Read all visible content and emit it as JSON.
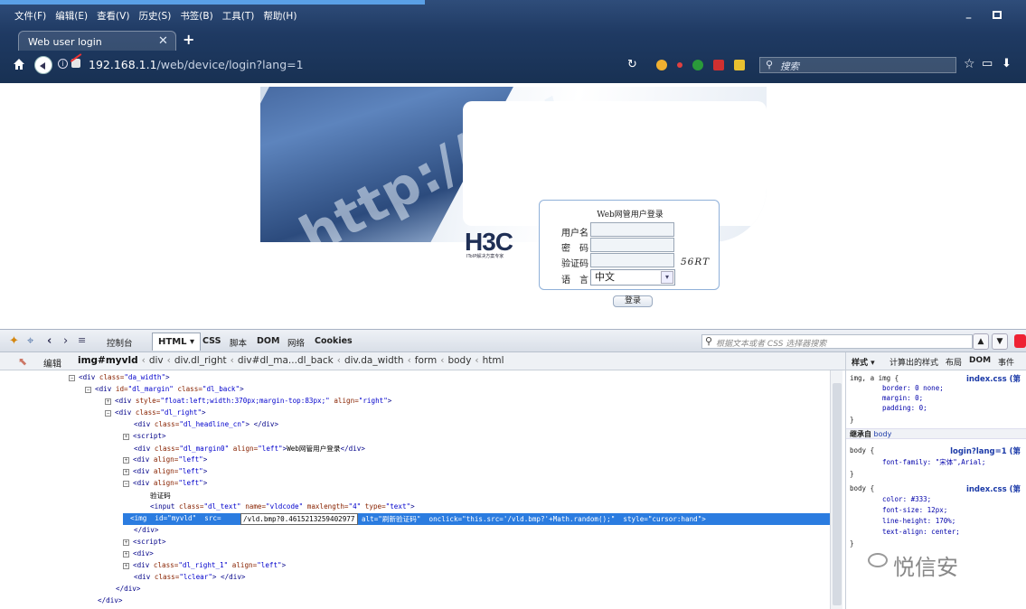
{
  "browser": {
    "menu": [
      "文件(F)",
      "编辑(E)",
      "查看(V)",
      "历史(S)",
      "书签(B)",
      "工具(T)",
      "帮助(H)"
    ],
    "tab_title": "Web user login",
    "tab_close": "✕",
    "new_tab": "+",
    "url_host": "192.168.1.1",
    "url_path": "/web/device/login?lang=1",
    "search_placeholder": "搜索",
    "minimize": "–"
  },
  "login_page": {
    "banner_text": "http://ww",
    "logo": "H3C",
    "logo_tagline": "IToIP解决方案专家",
    "title": "Web网管用户登录",
    "username_label": "用户名",
    "password_label": "密　码",
    "captcha_label": "验证码",
    "captcha_value": "56RT",
    "language_label": "语　言",
    "language_value": "中文",
    "login_button": "登录"
  },
  "firebug": {
    "tabs": [
      "控制台",
      "HTML ▾",
      "CSS",
      "脚本",
      "DOM",
      "网络",
      "Cookies"
    ],
    "search_placeholder": "根据文本或者 CSS 选择器搜索",
    "edit_label": "编辑",
    "breadcrumb_first": "img#myvld",
    "breadcrumbs": [
      "div",
      "div.dl_right",
      "div#dl_ma...dl_back",
      "div.da_width",
      "form",
      "body",
      "html"
    ],
    "edit_value": "/vld.bmp?0.4615213259402977",
    "side_tabs": [
      "样式 ▾",
      "计算出的样式",
      "布局",
      "DOM",
      "事件"
    ],
    "inherit_label": "继承自",
    "inherit_from": "body",
    "css_rules": [
      {
        "selector": "img, a img {",
        "source": "index.css (第",
        "props": [
          "border: 0 none;",
          "margin: 0;",
          "padding: 0;"
        ]
      },
      {
        "selector": "body {",
        "source": "login?lang=1 (第",
        "props": [
          "font-family: \"宋体\",Arial;"
        ]
      },
      {
        "selector": "body {",
        "source": "index.css (第",
        "props": [
          "color: #333;",
          "font-size: 12px;",
          "line-height: 170%;",
          "text-align: center;"
        ]
      }
    ]
  },
  "watermark": "悦信安",
  "colors": {
    "selection": "#2b7ce0",
    "chrome": "#1f3a63"
  }
}
